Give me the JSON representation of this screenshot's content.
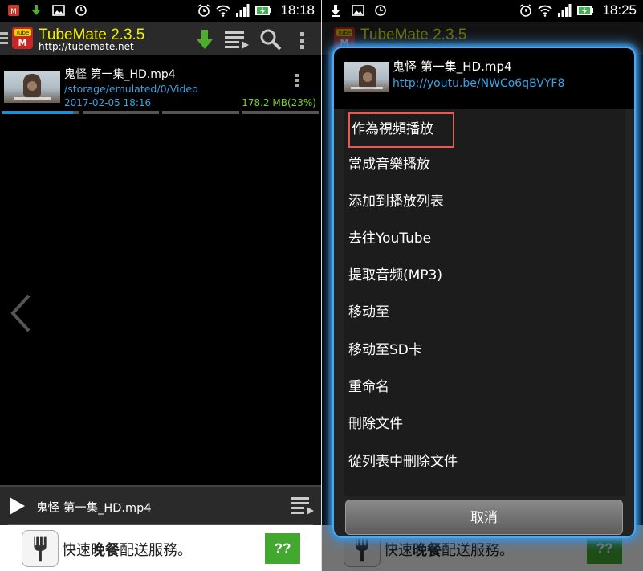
{
  "status_left": {
    "time": "18:18"
  },
  "status_right": {
    "time": "18:25"
  },
  "app": {
    "title": "TubeMate 2.3.5",
    "url": "http://tubemate.net"
  },
  "download_item": {
    "title": "鬼怪 第一集_HD.mp4",
    "path": "/storage/emulated/0/Video",
    "date": "2017-02-05 18:16",
    "size": "178.2 MB(23%)",
    "progress_fraction": 0.23
  },
  "player": {
    "title": "鬼怪 第一集_HD.mp4"
  },
  "ad": {
    "text_pre": "快速",
    "text_bold": "晚餐",
    "text_post": "配送服務。",
    "button_label": "??"
  },
  "dialog": {
    "title": "鬼怪 第一集_HD.mp4",
    "url": "http://youtu.be/NWCo6qBVYF8",
    "menu_items": [
      "作為視頻播放",
      "當成音樂播放",
      "添加到播放列表",
      "去往YouTube",
      "提取音频(MP3)",
      "移动至",
      "移动至SD卡",
      "重命名",
      "刪除文件",
      "從列表中刪除文件"
    ],
    "cancel_label": "取消"
  },
  "colors": {
    "accent_blue": "#3aa3e6",
    "title_yellow": "#f2f200",
    "size_green": "#79d428",
    "highlight_red": "#e85a52",
    "ad_button_green": "#43a82f"
  },
  "icons": [
    "tubemate-logo-icon",
    "download-arrow-icon",
    "list-icon",
    "search-icon",
    "more-vert-icon",
    "alarm-icon",
    "wifi-icon",
    "signal-icon",
    "battery-charging-icon",
    "play-icon",
    "chevron-left-icon",
    "fork-icon"
  ]
}
